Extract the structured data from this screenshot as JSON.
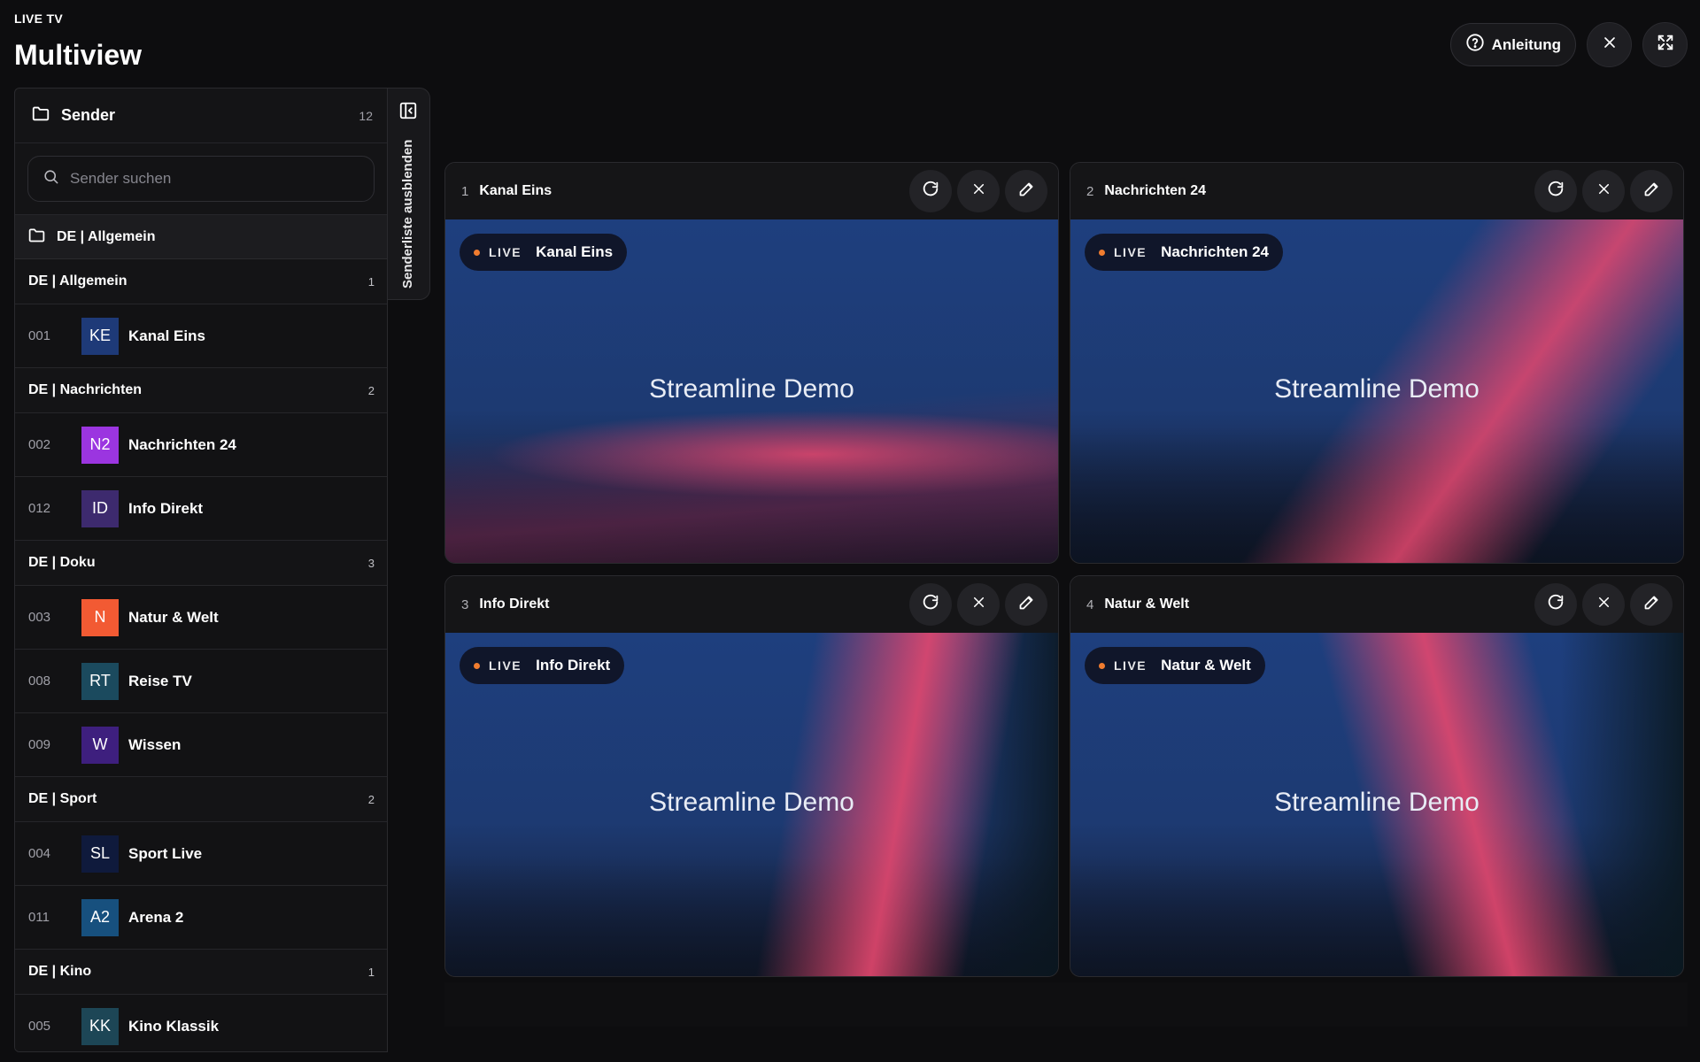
{
  "header": {
    "eyebrow": "LIVE TV",
    "title": "Multiview",
    "guide_label": "Anleitung"
  },
  "sidebar": {
    "title": "Sender",
    "count": "12",
    "search_placeholder": "Sender suchen",
    "folder_label": "DE | Allgemein",
    "toggle_label": "Senderliste ausblenden",
    "groups": [
      {
        "name": "DE | Allgemein",
        "count": "1",
        "channels": [
          {
            "num": "001",
            "abbr": "KE",
            "name": "Kanal Eins",
            "color": "#1e3a78"
          }
        ]
      },
      {
        "name": "DE | Nachrichten",
        "count": "2",
        "channels": [
          {
            "num": "002",
            "abbr": "N2",
            "name": "Nachrichten 24",
            "color": "#9b35e0"
          },
          {
            "num": "012",
            "abbr": "ID",
            "name": "Info Direkt",
            "color": "#3d2a6e"
          }
        ]
      },
      {
        "name": "DE | Doku",
        "count": "3",
        "channels": [
          {
            "num": "003",
            "abbr": "N",
            "name": "Natur & Welt",
            "color": "#f25a33"
          },
          {
            "num": "008",
            "abbr": "RT",
            "name": "Reise TV",
            "color": "#1b4a5e"
          },
          {
            "num": "009",
            "abbr": "W",
            "name": "Wissen",
            "color": "#3e1f7e"
          }
        ]
      },
      {
        "name": "DE | Sport",
        "count": "2",
        "channels": [
          {
            "num": "004",
            "abbr": "SL",
            "name": "Sport Live",
            "color": "#0f1a3c"
          },
          {
            "num": "011",
            "abbr": "A2",
            "name": "Arena 2",
            "color": "#17507e"
          }
        ]
      },
      {
        "name": "DE | Kino",
        "count": "1",
        "channels": [
          {
            "num": "005",
            "abbr": "KK",
            "name": "Kino Klassik",
            "color": "#1d4656"
          }
        ]
      }
    ]
  },
  "tiles": [
    {
      "num": "1",
      "name": "Kanal Eins",
      "live_label": "LIVE",
      "watermark": "Streamline Demo"
    },
    {
      "num": "2",
      "name": "Nachrichten 24",
      "live_label": "LIVE",
      "watermark": "Streamline Demo"
    },
    {
      "num": "3",
      "name": "Info Direkt",
      "live_label": "LIVE",
      "watermark": "Streamline Demo"
    },
    {
      "num": "4",
      "name": "Natur & Welt",
      "live_label": "LIVE",
      "watermark": "Streamline Demo"
    }
  ],
  "colors": {
    "background": "#0d0d0f",
    "live_dot": "#f07c2f",
    "accent_glow": "#e4476e",
    "video_blue": "#1e3f7e"
  }
}
